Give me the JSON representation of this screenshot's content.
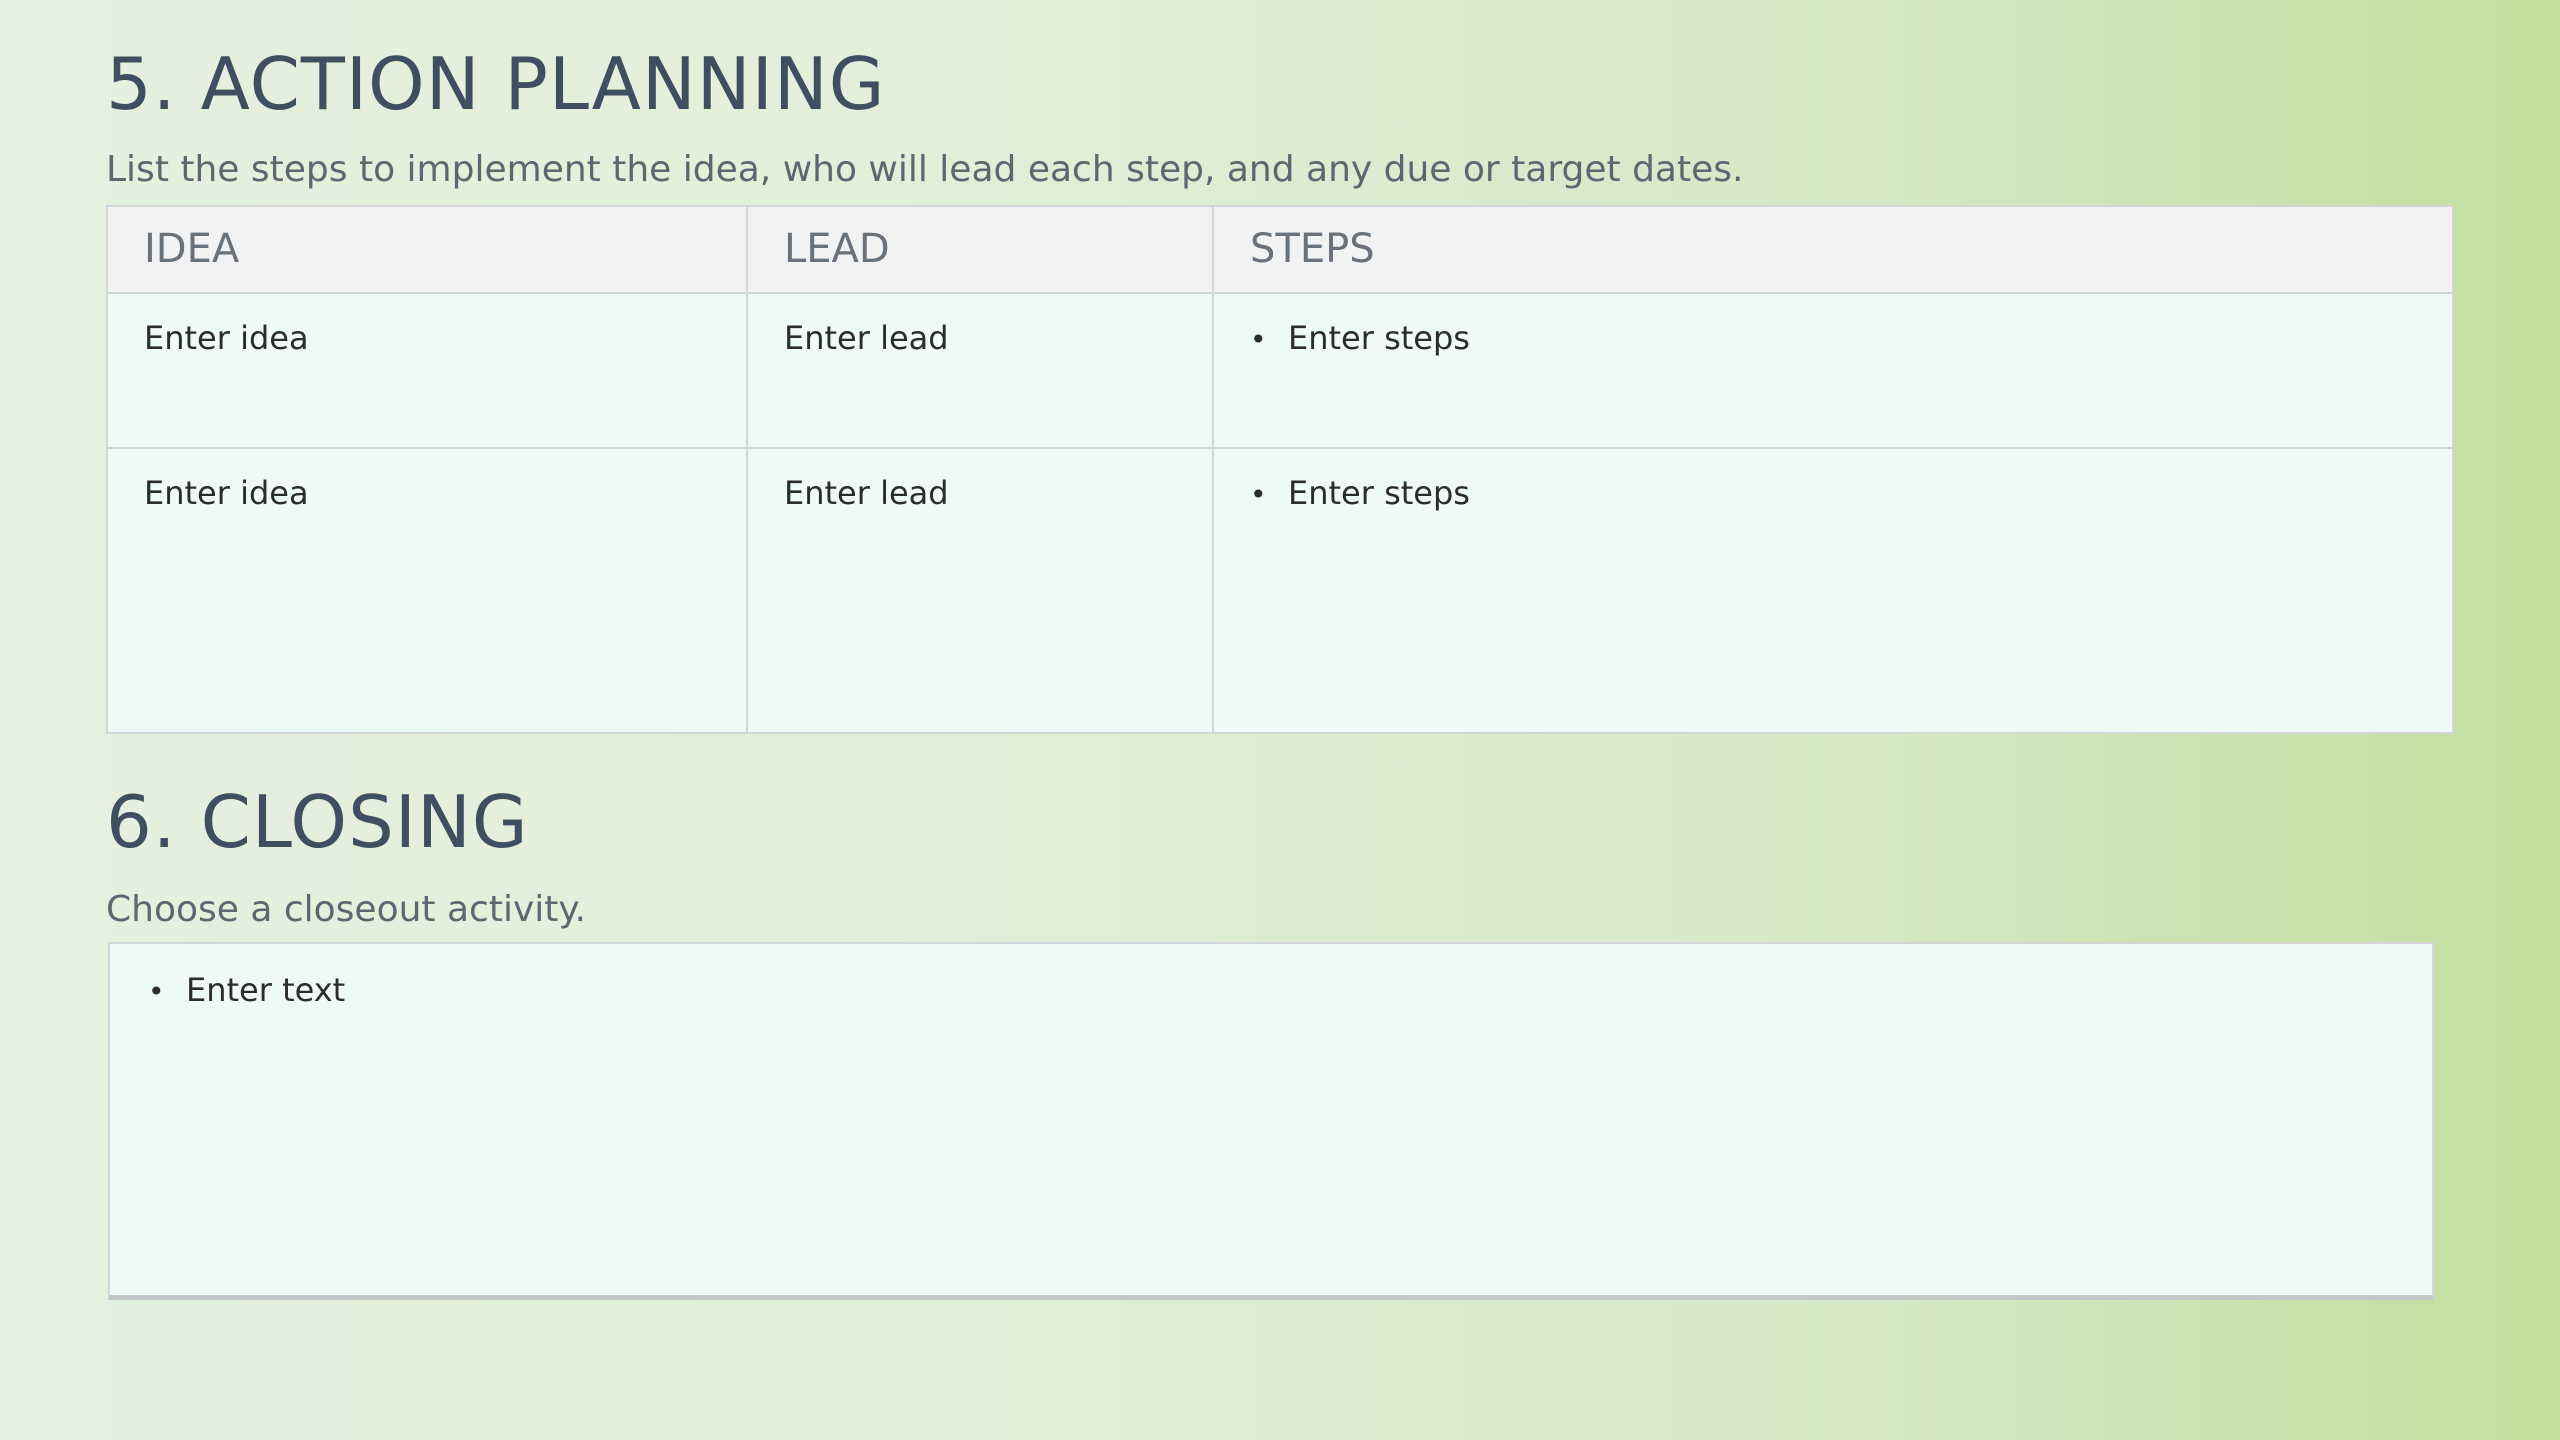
{
  "action_planning": {
    "title": "5. ACTION PLANNING",
    "description": "List the steps to implement the idea, who will lead each step, and any due or target dates.",
    "columns": [
      "IDEA",
      "LEAD",
      "STEPS"
    ],
    "rows": [
      {
        "idea": "Enter idea",
        "lead": "Enter lead",
        "steps": [
          "Enter steps"
        ]
      },
      {
        "idea": "Enter idea",
        "lead": "Enter lead",
        "steps": [
          "Enter steps"
        ]
      }
    ]
  },
  "closing": {
    "title": "6. CLOSING",
    "description": "Choose a closeout activity.",
    "items": [
      "Enter text"
    ]
  },
  "bullet_glyph": "•",
  "colors": {
    "heading": "#3f4f62",
    "cell_background": "#eefaf8",
    "header_background": "#f2f2f2",
    "page_background_left": "#e5f1df",
    "page_background_right": "#c2df9f"
  }
}
